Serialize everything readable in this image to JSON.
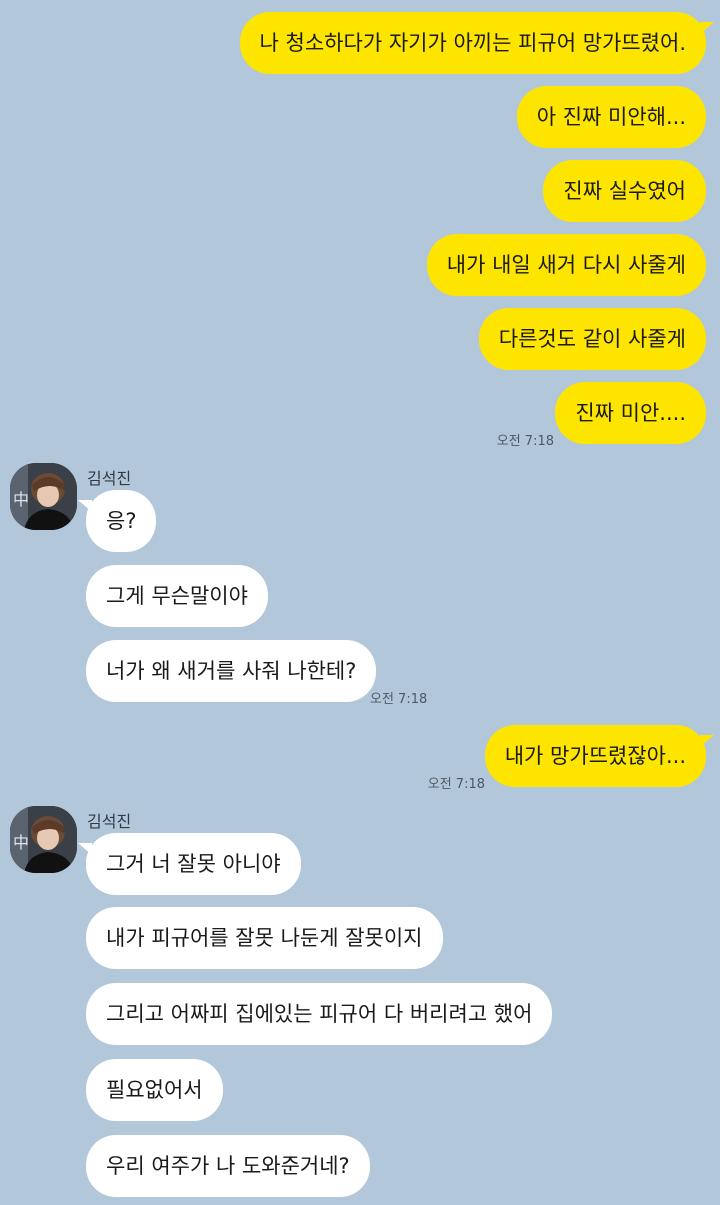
{
  "sent_1": {
    "messages": [
      "나 청소하다가 자기가 아끼는 피규어 망가뜨렸어.",
      "아 진짜 미안해...",
      "진짜 실수였어",
      "내가 내일 새거 다시 사줄게",
      "다른것도 같이 사줄게",
      "진짜 미안...."
    ],
    "time": "오전 7:18"
  },
  "received_1": {
    "sender": "김석진",
    "messages": [
      "응?",
      "그게 무슨말이야",
      "너가 왜 새거를 사줘 나한테?"
    ],
    "time": "오전 7:18"
  },
  "sent_2": {
    "messages": [
      "내가 망가뜨렸잖아..."
    ],
    "time": "오전 7:18"
  },
  "received_2": {
    "sender": "김석진",
    "messages": [
      "그거 너 잘못 아니야",
      "내가 피규어를 잘못 나둔게 잘못이지",
      "그리고 어짜피 집에있는 피규어 다 버리려고 했어",
      "필요없어서",
      "우리 여주가 나 도와준거네?"
    ]
  },
  "colors": {
    "background": "#b2c7d9",
    "sent_bubble": "#fee500",
    "received_bubble": "#ffffff"
  },
  "icons": {
    "avatar": "profile-photo-avatar"
  }
}
